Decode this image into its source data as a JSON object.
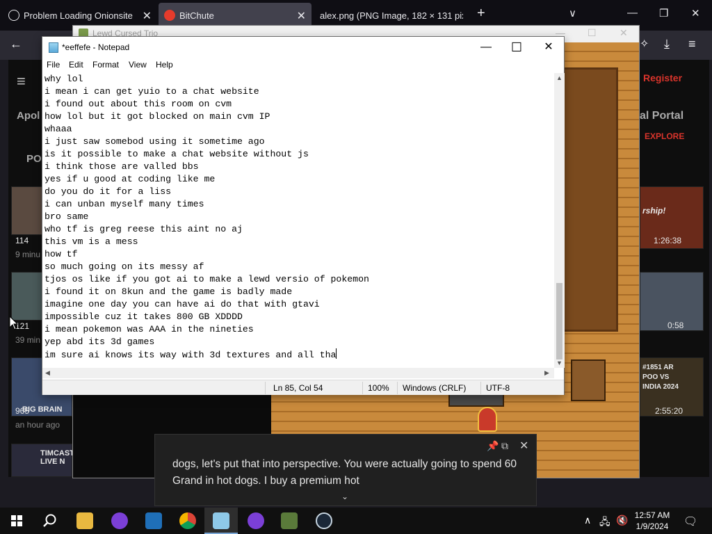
{
  "browser": {
    "tabs": [
      {
        "title": "Problem Loading Onionsite"
      },
      {
        "title": "BitChute"
      },
      {
        "title": "alex.png (PNG Image, 182 × 131 pix"
      }
    ],
    "new_tab": "+",
    "tab_list": "∨"
  },
  "website": {
    "register": "Register",
    "portal": "al Portal",
    "explore": "EXPLORE",
    "apol": "Apol",
    "po": "PO",
    "thumbs": [
      {
        "views": "114",
        "age": "9 minu",
        "duration": "1:26:38"
      },
      {
        "views": "121",
        "age": "39 min",
        "duration": "0:58"
      },
      {
        "views": "965",
        "age": "an hour ago",
        "duration": "2:55:20"
      }
    ],
    "thumb_labels": [
      "BIG BRAIN",
      "TIMCAST LIVE N",
      "#1851 AR POO VS INDIA 2024",
      "rship!"
    ]
  },
  "game": {
    "title": "Lewd Cursed Trio"
  },
  "notepad": {
    "title": "*eeffefe - Notepad",
    "menu": [
      "File",
      "Edit",
      "Format",
      "View",
      "Help"
    ],
    "lines": [
      "why lol",
      "i mean i can get yuio to a chat website",
      "i found out about this room on cvm",
      "how lol but it got blocked on main cvm IP",
      "whaaa",
      "i just saw somebod using it sometime ago",
      "is it possible to make a chat website without js",
      "i think those are valled bbs",
      "yes if u good at coding like me",
      "do you do it for a liss",
      "i can unban myself many times",
      "bro same",
      "who tf is greg reese this aint no aj",
      "this vm is a mess",
      "how tf",
      "so much going on its messy af",
      "tjos os like if you got ai to make a lewd versio of pokemon",
      "i found it on 8kun and the game is badly made",
      "imagine one day you can have ai do that with gtavi",
      "impossible cuz it takes 800 GB XDDDD",
      "i mean pokemon was AAA in the nineties",
      "yep abd its 3d games",
      "im sure ai knows its way with 3d textures and all tha"
    ],
    "status": {
      "position": "Ln 85, Col 54",
      "zoom": "100%",
      "line_ending": "Windows (CRLF)",
      "encoding": "UTF-8"
    }
  },
  "caption": {
    "text": "dogs, let's put that into perspective. You were actually going to spend 60 Grand in hot dogs. I buy a premium hot"
  },
  "taskbar": {
    "time": "12:57 AM",
    "date": "1/9/2024",
    "icons": [
      "start",
      "search",
      "file-explorer",
      "tor-browser",
      "virtualbox",
      "chrome",
      "notepad",
      "tor-browser-2",
      "game",
      "steam"
    ]
  }
}
